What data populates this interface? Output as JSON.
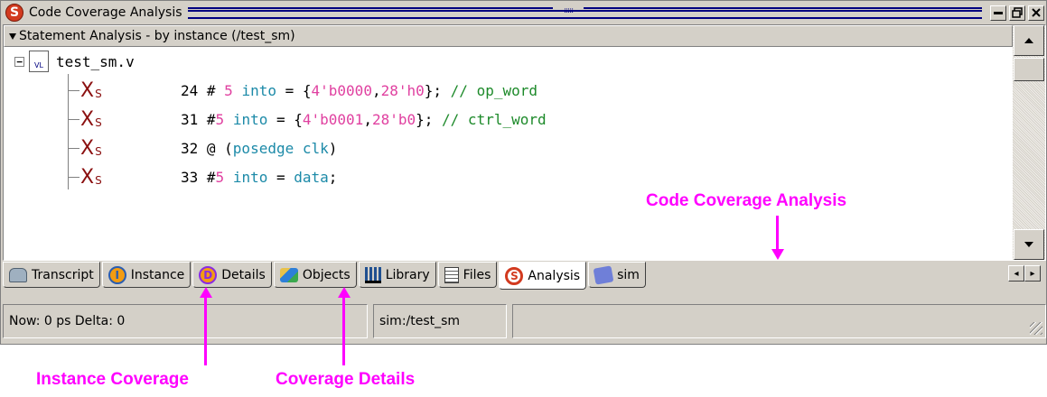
{
  "window": {
    "title": "Code Coverage Analysis",
    "app_icon_letter": "S",
    "grip": ":::::",
    "buttons": [
      "minimize",
      "restore",
      "close"
    ]
  },
  "analysis": {
    "header": "Statement Analysis - by instance (/test_sm)",
    "file": {
      "name": "test_sm.v",
      "icon_label": "VL",
      "expand_symbol": "−"
    },
    "statements": [
      {
        "marker": "X",
        "marker_sub": "S",
        "line": "24",
        "parts": [
          {
            "t": " # ",
            "c": "ln"
          },
          {
            "t": "5",
            "c": "num"
          },
          {
            "t": " ",
            "c": "ln"
          },
          {
            "t": "into",
            "c": "kw"
          },
          {
            "t": " = {",
            "c": "ln"
          },
          {
            "t": "4'b0000",
            "c": "num"
          },
          {
            "t": ",",
            "c": "ln"
          },
          {
            "t": "28'h0",
            "c": "num"
          },
          {
            "t": "}; ",
            "c": "ln"
          },
          {
            "t": "// op_word",
            "c": "cm"
          }
        ]
      },
      {
        "marker": "X",
        "marker_sub": "S",
        "line": "31",
        "parts": [
          {
            "t": " #",
            "c": "ln"
          },
          {
            "t": "5",
            "c": "num"
          },
          {
            "t": " ",
            "c": "ln"
          },
          {
            "t": "into",
            "c": "kw"
          },
          {
            "t": " = {",
            "c": "ln"
          },
          {
            "t": "4'b0001",
            "c": "num"
          },
          {
            "t": ",",
            "c": "ln"
          },
          {
            "t": "28'b0",
            "c": "num"
          },
          {
            "t": "}; ",
            "c": "ln"
          },
          {
            "t": "// ctrl_word",
            "c": "cm"
          }
        ]
      },
      {
        "marker": "X",
        "marker_sub": "S",
        "line": "32",
        "parts": [
          {
            "t": " @ (",
            "c": "ln"
          },
          {
            "t": "posedge",
            "c": "kw"
          },
          {
            "t": " ",
            "c": "ln"
          },
          {
            "t": "clk",
            "c": "kw"
          },
          {
            "t": ")",
            "c": "ln"
          }
        ]
      },
      {
        "marker": "X",
        "marker_sub": "S",
        "line": "33",
        "parts": [
          {
            "t": " #",
            "c": "ln"
          },
          {
            "t": "5",
            "c": "num"
          },
          {
            "t": " ",
            "c": "ln"
          },
          {
            "t": "into",
            "c": "kw"
          },
          {
            "t": " = ",
            "c": "ln"
          },
          {
            "t": "data",
            "c": "kw"
          },
          {
            "t": ";",
            "c": "ln"
          }
        ]
      }
    ]
  },
  "tabs": [
    {
      "label": "Transcript",
      "icon": "transcript-icon",
      "active": false
    },
    {
      "label": "Instance",
      "icon": "instance-icon",
      "letter": "I",
      "active": false
    },
    {
      "label": "Details",
      "icon": "details-icon",
      "letter": "D",
      "active": false
    },
    {
      "label": "Objects",
      "icon": "objects-icon",
      "active": false
    },
    {
      "label": "Library",
      "icon": "library-icon",
      "active": false
    },
    {
      "label": "Files",
      "icon": "files-icon",
      "active": false
    },
    {
      "label": "Analysis",
      "icon": "analysis-icon",
      "letter": "S",
      "active": true
    },
    {
      "label": "sim",
      "icon": "sim-icon",
      "active": false
    }
  ],
  "tab_nav": {
    "prev": "◂",
    "next": "▸"
  },
  "status": {
    "time": "Now: 0 ps  Delta: 0",
    "context": "sim:/test_sm",
    "extra": ""
  },
  "callouts": {
    "code_coverage": "Code Coverage Analysis",
    "instance": "Instance Coverage",
    "details": "Coverage Details"
  },
  "colors": {
    "keyword": "#1c8aa8",
    "number": "#e040a0",
    "comment": "#1d8a2a",
    "marker": "#8b1010",
    "callout": "#ff00ff"
  }
}
